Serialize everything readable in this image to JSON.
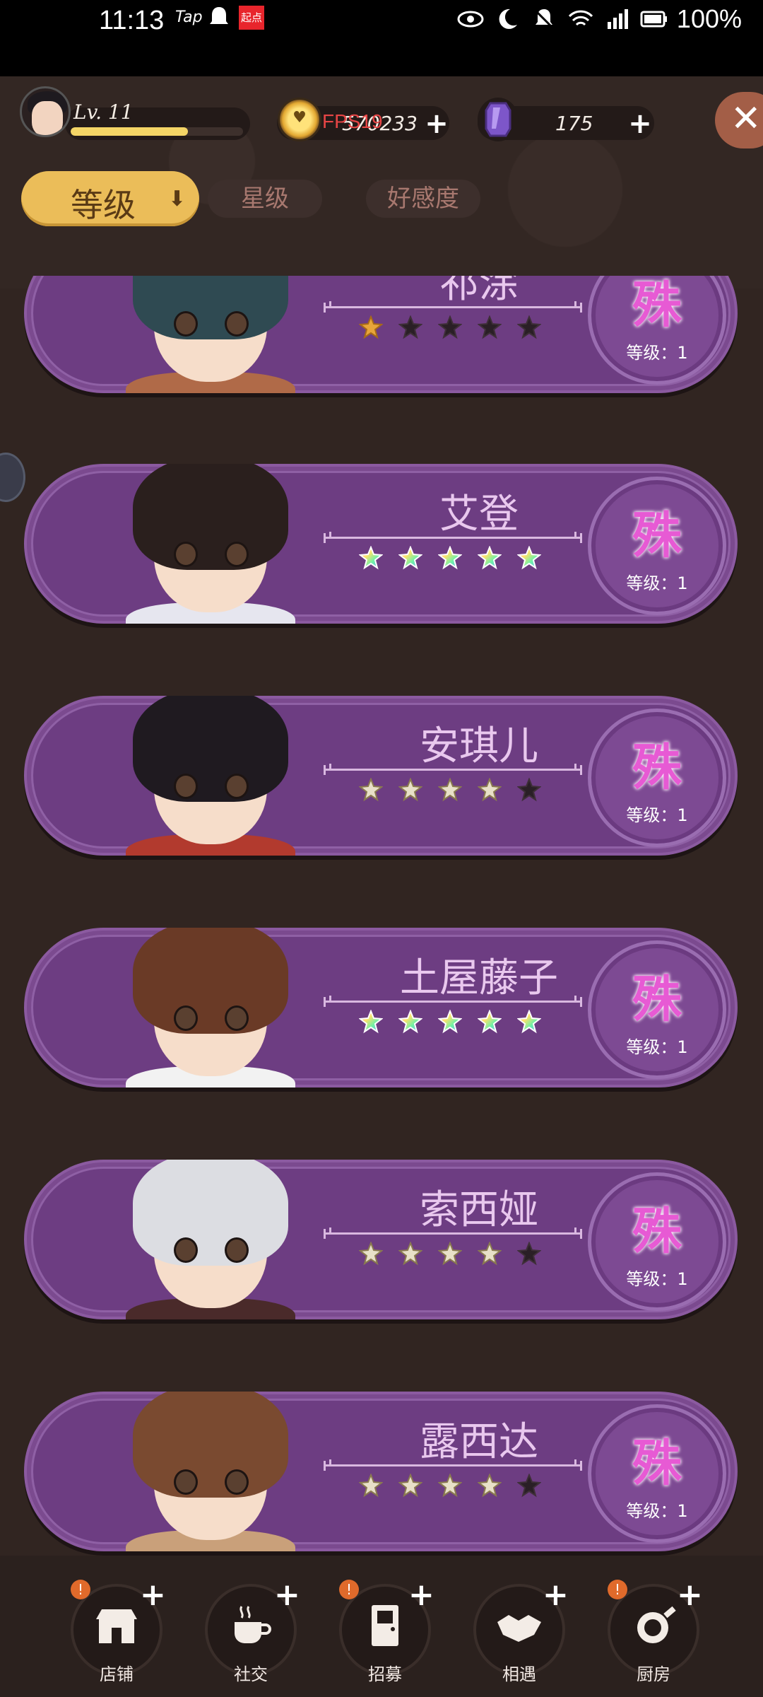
{
  "status_bar": {
    "time": "11:13",
    "tap": "Tap",
    "qidian": "起点",
    "battery": "100%"
  },
  "player": {
    "level_label": "Lv. 11",
    "xp_fraction": 0.68
  },
  "currency": {
    "gold": "570233",
    "gems": "175",
    "fps_overlay": "FPS19"
  },
  "tabs": [
    {
      "label": "等级",
      "active": true,
      "icon": "sort-arrow-down"
    },
    {
      "label": "星级",
      "active": false
    },
    {
      "label": "好感度",
      "active": false
    }
  ],
  "characters": [
    {
      "name": "祁涂",
      "stars_filled": 1,
      "star_style": "gold",
      "badge": "殊",
      "level": "等级：1",
      "hair": "#2f4a52",
      "cloth": "#b06a48"
    },
    {
      "name": "艾登",
      "stars_filled": 5,
      "star_style": "rainbow",
      "badge": "殊",
      "level": "等级：1",
      "hair": "#2a1f1d",
      "cloth": "#e6e6ef"
    },
    {
      "name": "安琪儿",
      "stars_filled": 4,
      "star_style": "silver",
      "badge": "殊",
      "level": "等级：1",
      "hair": "#1f1a20",
      "cloth": "#b23a2e"
    },
    {
      "name": "土屋藤子",
      "stars_filled": 5,
      "star_style": "rainbow",
      "badge": "殊",
      "level": "等级：1",
      "hair": "#6a3a26",
      "cloth": "#f2f2f2"
    },
    {
      "name": "索西娅",
      "stars_filled": 4,
      "star_style": "silver",
      "badge": "殊",
      "level": "等级：1",
      "hair": "#dcdde2",
      "cloth": "#4a2a2a"
    },
    {
      "name": "露西达",
      "stars_filled": 4,
      "star_style": "silver",
      "badge": "殊",
      "level": "等级：1",
      "hair": "#7a4a30",
      "cloth": "#c9a07a"
    }
  ],
  "bottom_nav": [
    {
      "label": "店铺",
      "icon": "shop-icon",
      "alert": true
    },
    {
      "label": "社交",
      "icon": "coffee-cup-icon",
      "alert": false
    },
    {
      "label": "招募",
      "icon": "door-icon",
      "alert": true
    },
    {
      "label": "相遇",
      "icon": "handshake-icon",
      "alert": false
    },
    {
      "label": "厨房",
      "icon": "frying-pan-icon",
      "alert": true
    }
  ],
  "colors": {
    "accent_tab": "#ebbd59",
    "card_purple": "#6d3d82",
    "badge_glyph": "#e75ad4"
  }
}
